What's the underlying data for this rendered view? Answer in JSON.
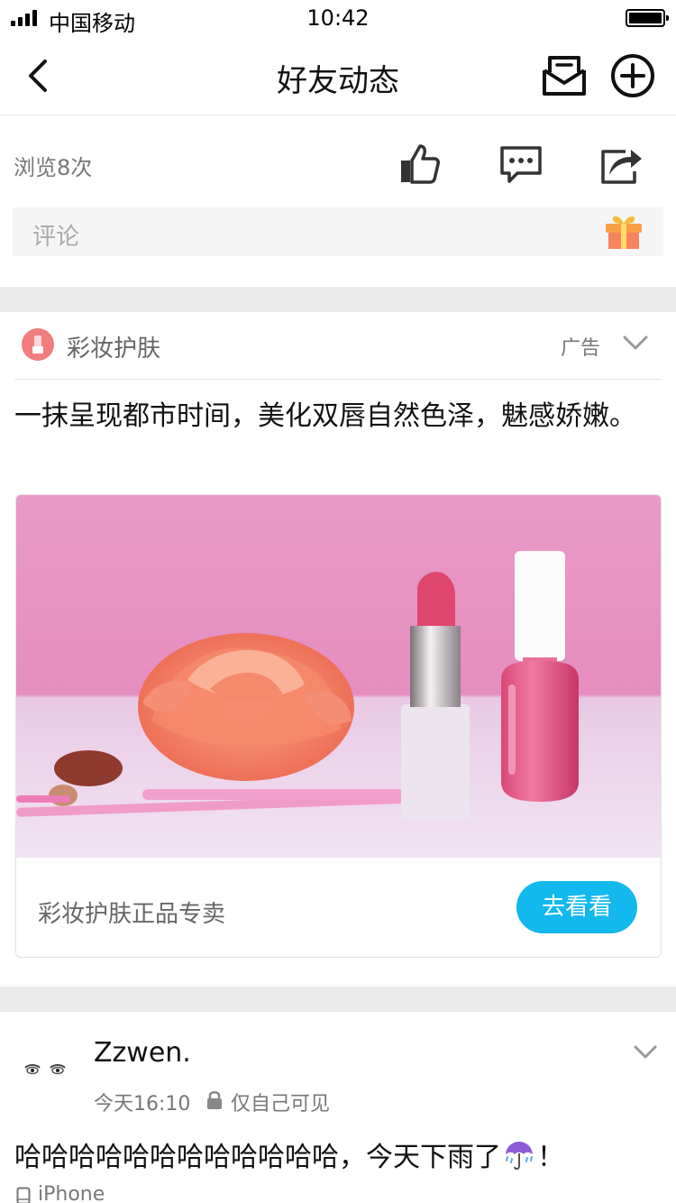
{
  "status_bar": {
    "carrier": "中国移动",
    "time": "10:42"
  },
  "nav": {
    "title": "好友动态"
  },
  "stats": {
    "views": "浏览8次"
  },
  "comment": {
    "placeholder": "评论"
  },
  "ad": {
    "brand": "彩妆护肤",
    "tag": "广告",
    "text": "一抹呈现都市时间，美化双唇自然色泽，魅感娇嫩。",
    "card_title": "彩妆护肤正品专卖",
    "button": "去看看"
  },
  "post": {
    "username": "Zzwen.",
    "time": "今天16:10",
    "privacy": "仅自己可见",
    "text_before": "哈哈哈哈哈哈哈哈哈哈哈哈，今天下雨了",
    "text_after": "！",
    "device": "iPhone"
  },
  "colors": {
    "accent": "#13b8ed",
    "ad_logo": "#f17d7d",
    "separator": "#ebebeb"
  },
  "icons": [
    "back-icon",
    "mail-icon",
    "add-icon",
    "like-icon",
    "comment-icon",
    "share-icon",
    "gift-icon",
    "chevron-down-icon",
    "lock-icon",
    "umbrella-rain-icon",
    "phone-icon"
  ]
}
